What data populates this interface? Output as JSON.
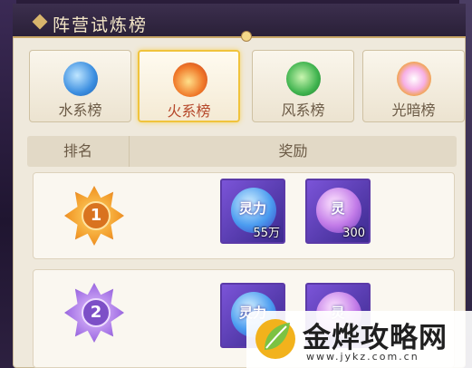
{
  "window": {
    "title": "阵营试炼榜"
  },
  "tabs": [
    {
      "label": "水系榜",
      "icon": "water-element-icon",
      "active": false
    },
    {
      "label": "火系榜",
      "icon": "fire-element-icon",
      "active": true
    },
    {
      "label": "风系榜",
      "icon": "wind-element-icon",
      "active": false
    },
    {
      "label": "光暗榜",
      "icon": "light-dark-element-icon",
      "active": false
    }
  ],
  "table": {
    "headers": {
      "rank": "排名",
      "reward": "奖励"
    },
    "rows": [
      {
        "rank": "1",
        "rewards": [
          {
            "name": "灵力",
            "count": "55万"
          },
          {
            "name": "灵",
            "count": "300"
          }
        ]
      },
      {
        "rank": "2",
        "rewards": [
          {
            "name": "灵力",
            "count": ""
          },
          {
            "name": "灵",
            "count": ""
          }
        ]
      }
    ]
  },
  "watermark": {
    "text": "金烨攻略网",
    "url": "www.jykz.com.cn"
  },
  "colors": {
    "accent": "#f0c33c",
    "title_bar": "#2f2440",
    "panel": "#efe9dc"
  }
}
